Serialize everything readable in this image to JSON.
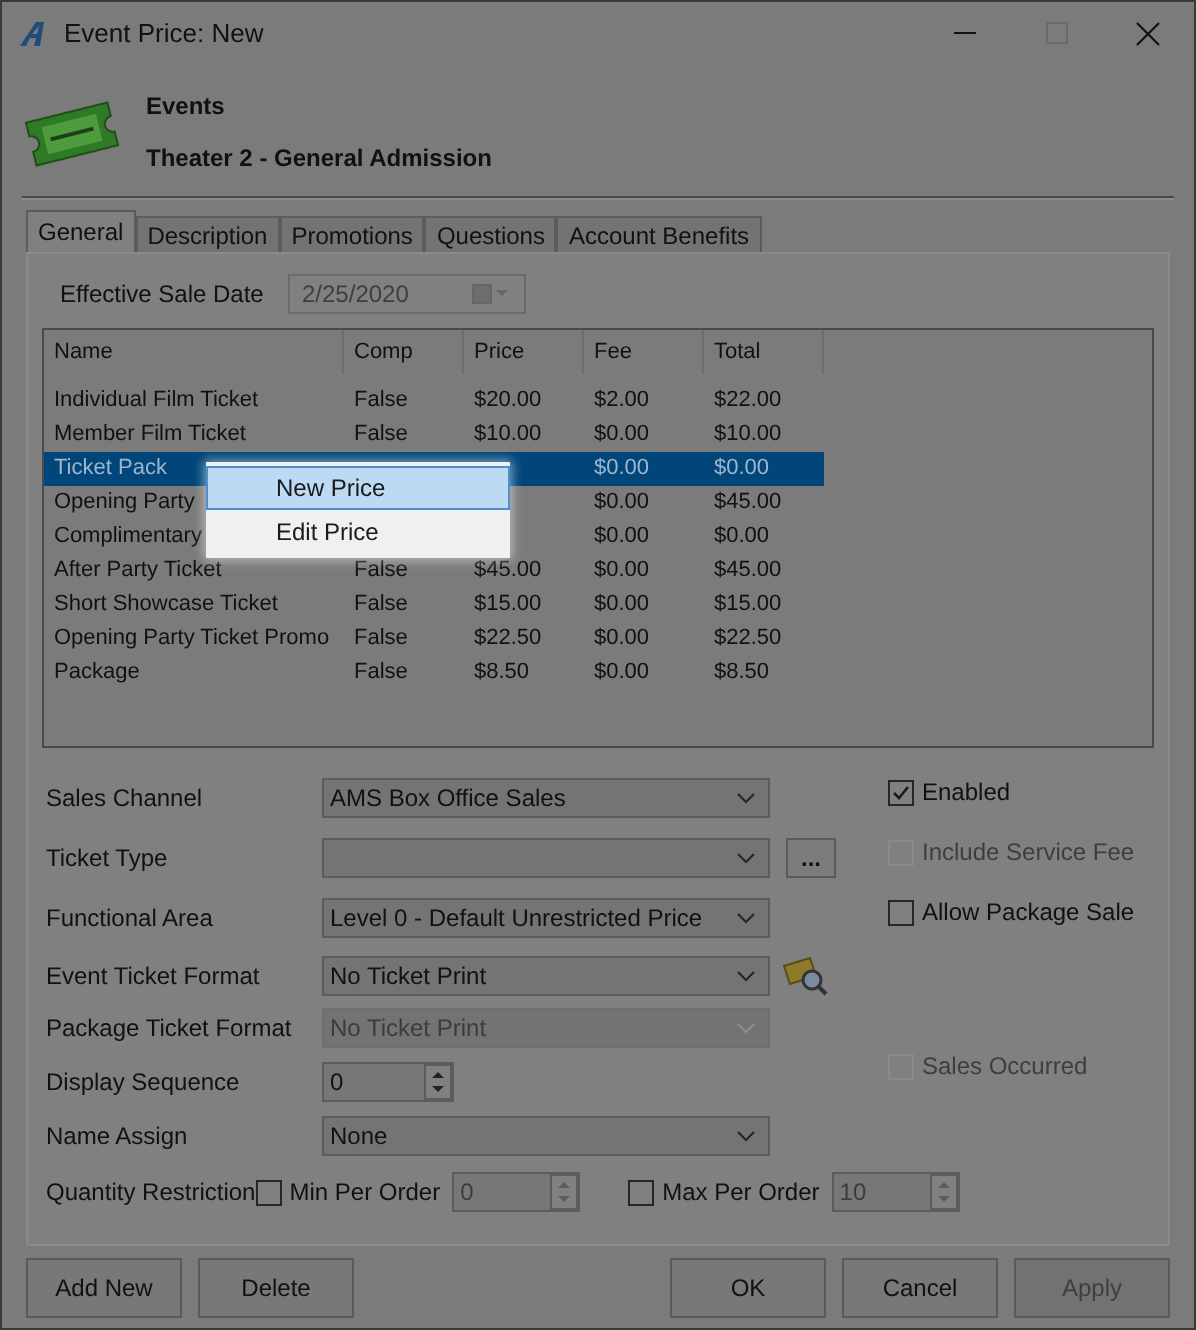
{
  "window": {
    "title": "Event Price: New"
  },
  "header": {
    "category": "Events",
    "name": "Theater 2 - General Admission"
  },
  "tabs": [
    {
      "label": "General",
      "selected": true
    },
    {
      "label": "Description",
      "selected": false
    },
    {
      "label": "Promotions",
      "selected": false
    },
    {
      "label": "Questions",
      "selected": false
    },
    {
      "label": "Account Benefits",
      "selected": false
    }
  ],
  "effective_sale_date": {
    "label": "Effective Sale Date",
    "value": "2/25/2020",
    "disabled": true
  },
  "table": {
    "columns": [
      "Name",
      "Comp",
      "Price",
      "Fee",
      "Total"
    ],
    "rows": [
      {
        "selected": false,
        "cells": [
          "Individual Film Ticket",
          "False",
          "$20.00",
          "$2.00",
          "$22.00"
        ]
      },
      {
        "selected": false,
        "cells": [
          "Member Film Ticket",
          "False",
          "$10.00",
          "$0.00",
          "$10.00"
        ]
      },
      {
        "selected": true,
        "cells": [
          "Ticket Pack",
          null,
          null,
          "$0.00",
          "$0.00"
        ]
      },
      {
        "selected": false,
        "cells": [
          "Opening Party",
          null,
          null,
          "$0.00",
          "$45.00"
        ]
      },
      {
        "selected": false,
        "cells": [
          "Complimentary",
          null,
          null,
          "$0.00",
          "$0.00"
        ]
      },
      {
        "selected": false,
        "cells": [
          "After Party Ticket",
          "False",
          "$45.00",
          "$0.00",
          "$45.00"
        ]
      },
      {
        "selected": false,
        "cells": [
          "Short Showcase Ticket",
          "False",
          "$15.00",
          "$0.00",
          "$15.00"
        ]
      },
      {
        "selected": false,
        "cells": [
          "Opening Party Ticket Promo",
          "False",
          "$22.50",
          "$0.00",
          "$22.50"
        ]
      },
      {
        "selected": false,
        "cells": [
          "Package",
          "False",
          "$8.50",
          "$0.00",
          "$8.50"
        ]
      }
    ]
  },
  "context_menu": [
    {
      "label": "New Price",
      "selected": true
    },
    {
      "label": "Edit Price",
      "selected": false
    }
  ],
  "fields": [
    {
      "kind": "combo",
      "label": "Sales Channel",
      "value": "AMS Box Office Sales",
      "disabled": false
    },
    {
      "kind": "combo_browse",
      "label": "Ticket Type",
      "button": "...",
      "disabled": false
    },
    {
      "kind": "combo",
      "label": "Functional Area",
      "value": "Level 0 - Default Unrestricted Price",
      "disabled": false
    },
    {
      "kind": "combo_preview",
      "label": "Event Ticket Format",
      "value": "No Ticket Print",
      "disabled": false
    },
    {
      "kind": "combo",
      "label": "Package Ticket Format",
      "value": "No Ticket Print",
      "disabled": true
    },
    {
      "kind": "spin",
      "label": "Display Sequence",
      "value": "0",
      "disabled": false
    },
    {
      "kind": "combo",
      "label": "Name Assign",
      "value": "None",
      "disabled": false
    },
    {
      "kind": "range",
      "label": "Quantity Restriction",
      "min": {
        "label": "Min Per Order",
        "checked": false,
        "value": "0"
      },
      "max": {
        "label": "Max Per Order",
        "checked": false,
        "value": "10"
      }
    }
  ],
  "options": [
    {
      "label": "Enabled",
      "checked": true,
      "disabled": false
    },
    {
      "label": "Include Service Fee",
      "checked": false,
      "disabled": true
    },
    {
      "label": "Allow Package Sale",
      "checked": false,
      "disabled": false
    },
    {
      "label": "Sales Occurred",
      "checked": false,
      "disabled": true
    }
  ],
  "buttons_left": [
    {
      "label": "Add New",
      "disabled": false
    },
    {
      "label": "Delete",
      "disabled": false
    }
  ],
  "buttons_right": [
    {
      "label": "OK",
      "disabled": false
    },
    {
      "label": "Cancel",
      "disabled": false
    },
    {
      "label": "Apply",
      "disabled": true
    }
  ]
}
